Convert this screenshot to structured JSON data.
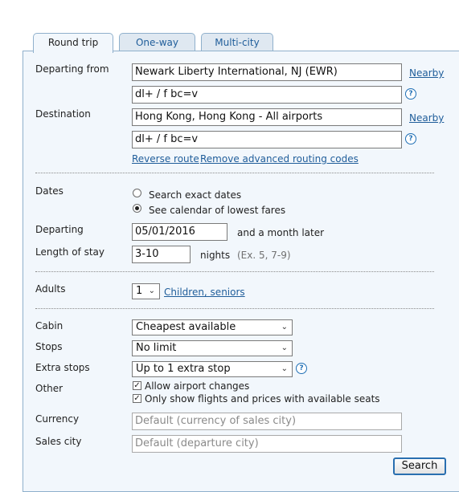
{
  "tabs": [
    {
      "label": "Round trip",
      "active": true
    },
    {
      "label": "One-way",
      "active": false
    },
    {
      "label": "Multi-city",
      "active": false
    }
  ],
  "departing_from": {
    "label": "Departing from",
    "value": "Newark Liberty International, NJ (EWR)",
    "routing_code": "dl+ / f bc=v",
    "nearby_link": "Nearby"
  },
  "destination": {
    "label": "Destination",
    "value": "Hong Kong, Hong Kong - All airports",
    "routing_code": "dl+ / f bc=v",
    "nearby_link": "Nearby"
  },
  "route_links": {
    "reverse": "Reverse route",
    "remove_advanced": "Remove advanced routing codes"
  },
  "dates": {
    "label": "Dates",
    "options": [
      {
        "label": "Search exact dates",
        "selected": false
      },
      {
        "label": "See calendar of lowest fares",
        "selected": true
      }
    ],
    "departing_label": "Departing",
    "departing_value": "05/01/2016",
    "departing_suffix": "and a month later",
    "length_label": "Length of stay",
    "length_value": "3-10",
    "length_unit": "nights",
    "length_example": "(Ex. 5, 7-9)"
  },
  "passengers": {
    "adults_label": "Adults",
    "adults_value": "1",
    "children_link": "Children, seniors"
  },
  "options": {
    "cabin_label": "Cabin",
    "cabin_value": "Cheapest available",
    "stops_label": "Stops",
    "stops_value": "No limit",
    "extra_stops_label": "Extra stops",
    "extra_stops_value": "Up to 1 extra stop",
    "other_label": "Other",
    "checkboxes": [
      {
        "label": "Allow airport changes",
        "checked": true
      },
      {
        "label": "Only show flights and prices with available seats",
        "checked": true
      }
    ],
    "currency_label": "Currency",
    "currency_placeholder": "Default (currency of sales city)",
    "sales_city_label": "Sales city",
    "sales_city_placeholder": "Default (departure city)"
  },
  "search_button": "Search",
  "help_glyph": "?",
  "colors": {
    "link": "#1f5d9a",
    "panel_bg": "#f2f7fc",
    "panel_border": "#8fb0cc",
    "help_icon": "#1f6fb5"
  }
}
